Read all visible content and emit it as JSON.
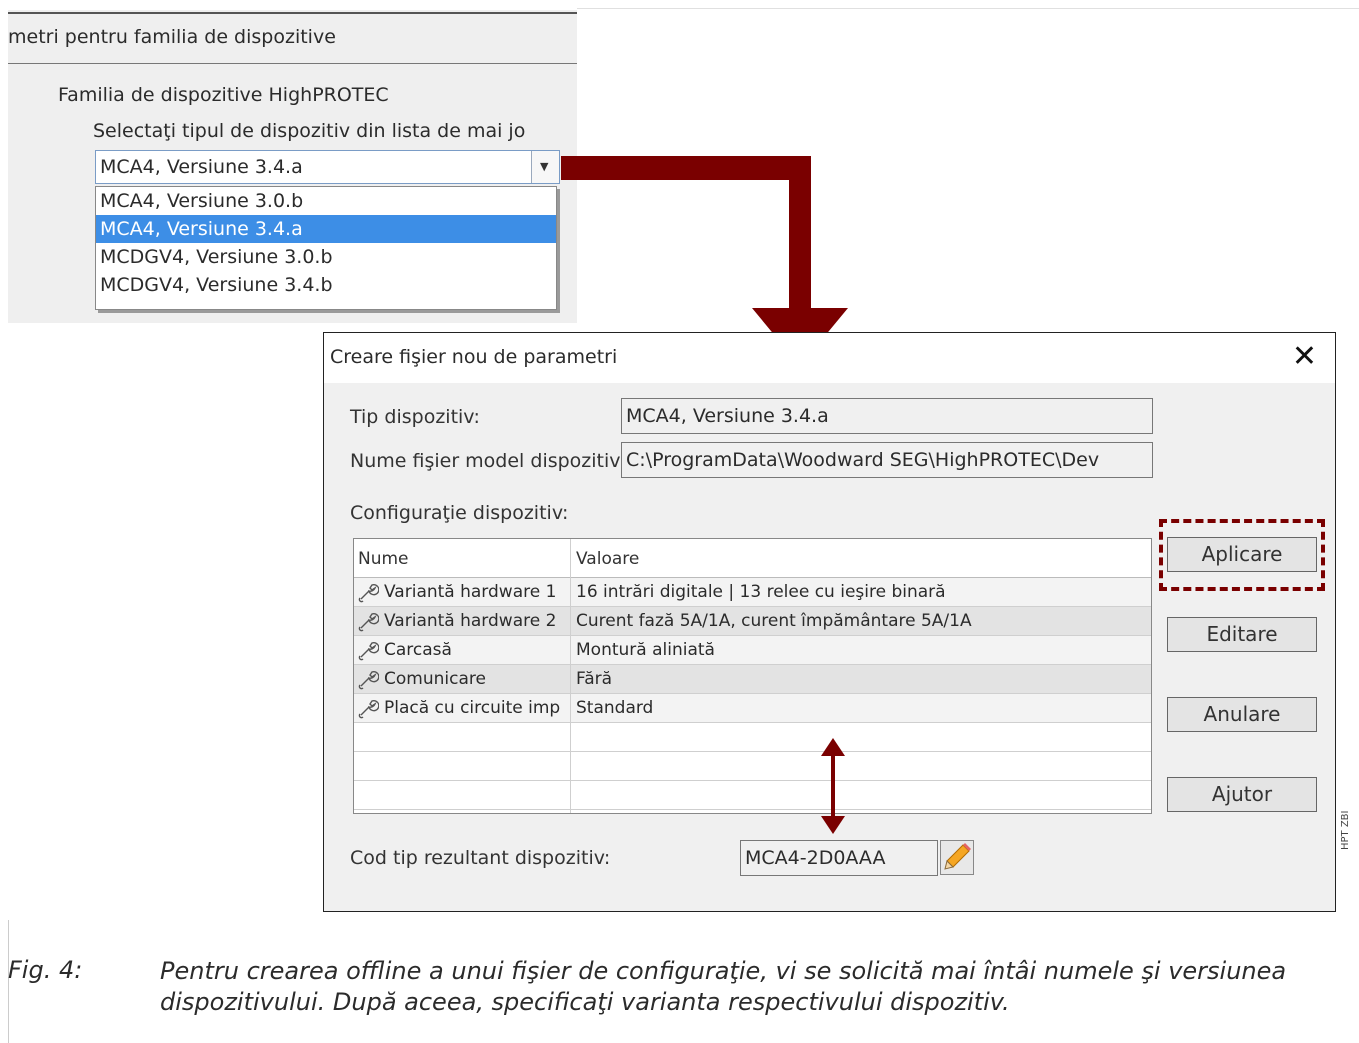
{
  "top_panel": {
    "header": "metri pentru familia de dispozitive",
    "family_label": "Familia de dispozitive HighPROTEC",
    "select_label": "Selectaţi tipul de dispozitiv din lista de mai jo",
    "dropdown_value": "MCA4, Versiune 3.4.a",
    "options": [
      "MCA4, Versiune 3.0.b",
      "MCA4, Versiune 3.4.a",
      "MCDGV4, Versiune 3.0.b",
      "MCDGV4, Versiune 3.4.b"
    ],
    "selected_index": 1
  },
  "dialog": {
    "title": "Creare fişier nou de parametri",
    "close_icon": "close-icon",
    "device_type_label": "Tip dispozitiv:",
    "device_type_value": "MCA4, Versiune 3.4.a",
    "model_file_label": "Nume fişier model dispozitiv:",
    "model_file_value": "C:\\ProgramData\\Woodward SEG\\HighPROTEC\\Dev",
    "config_label": "Configuraţie dispozitiv:",
    "table": {
      "headers": [
        "Nume",
        "Valoare"
      ],
      "rows": [
        {
          "name": "Variantă hardware 1",
          "value": "16 intrări digitale | 13 relee cu ieşire binară"
        },
        {
          "name": "Variantă hardware 2",
          "value": "Curent fază 5A/1A, curent împământare 5A/1A"
        },
        {
          "name": "Carcasă",
          "value": "Montură aliniată"
        },
        {
          "name": "Comunicare",
          "value": "Fără"
        },
        {
          "name": "Placă cu circuite imp",
          "value": "Standard"
        }
      ]
    },
    "buttons": {
      "apply": "Aplicare",
      "edit": "Editare",
      "cancel": "Anulare",
      "help": "Ajutor"
    },
    "result_label": "Cod tip rezultant dispozitiv:",
    "result_value": "MCA4-2D0AAA"
  },
  "caption": {
    "number": "Fig. 4:",
    "text": "Pentru crearea offline a unui fişier de configuraţie, vi se solicită mai întâi numele şi versiunea dispozitivului. După aceea, specificaţi varianta respectivului dispozitiv."
  },
  "side_tag": "HPT ZBI",
  "colors": {
    "accent_red": "#7a0000",
    "selection_blue": "#3d8ee6"
  }
}
